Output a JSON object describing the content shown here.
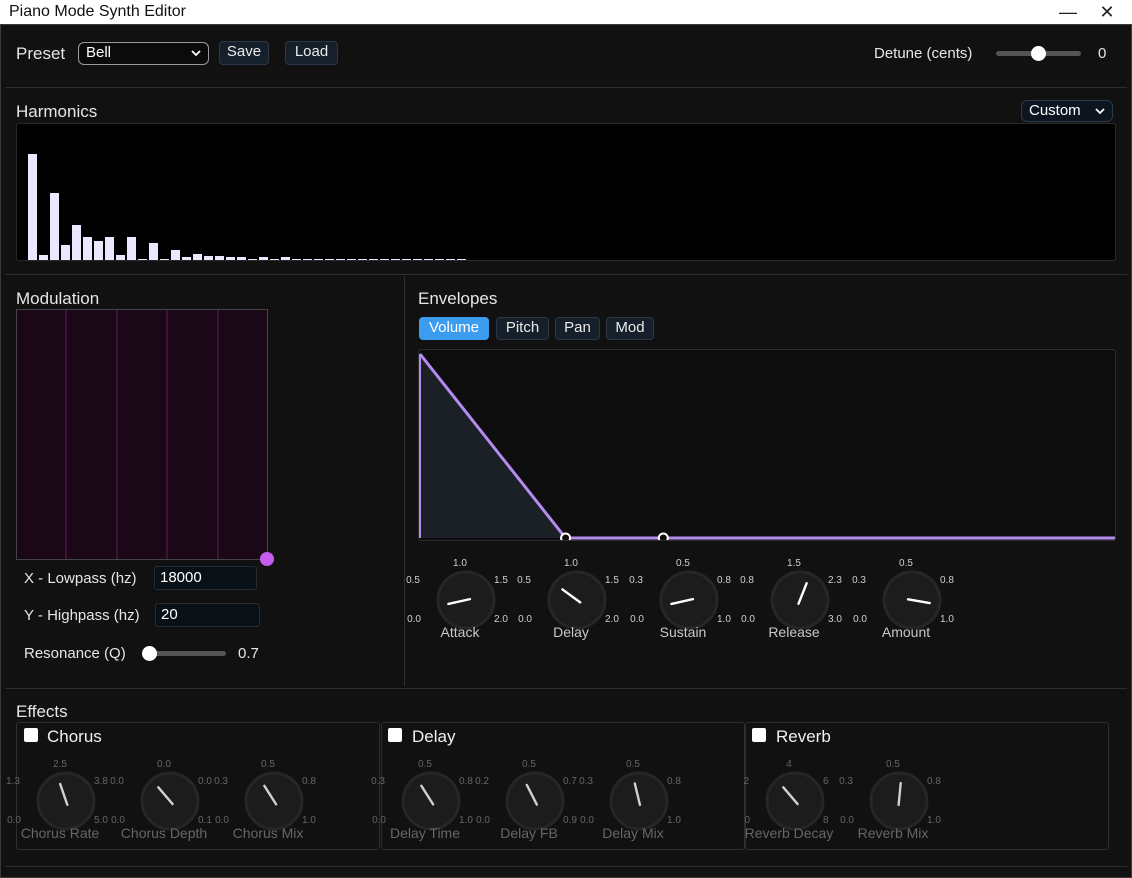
{
  "window": {
    "title": "Piano Mode Synth Editor",
    "minimize_glyph": "—",
    "close_glyph": "✕"
  },
  "preset": {
    "label": "Preset",
    "selected": "Bell",
    "save_label": "Save",
    "load_label": "Load"
  },
  "detune": {
    "label": "Detune (cents)",
    "value": "0",
    "level": 0.5
  },
  "harmonics": {
    "title": "Harmonics",
    "mode_selected": "Custom",
    "levels": [
      0.83,
      0.04,
      0.52,
      0.12,
      0.27,
      0.18,
      0.15,
      0.18,
      0.04,
      0.18,
      0.01,
      0.13,
      0.0,
      0.08,
      0.02,
      0.05,
      0.03,
      0.03,
      0.02,
      0.02,
      0.01,
      0.02,
      0.0,
      0.02,
      0.0,
      0.01,
      0.0,
      0.01,
      0.0,
      0.01,
      0.0,
      0.005,
      0.005,
      0.005,
      0.005,
      0.005,
      0.005,
      0.005,
      0.005,
      0.005
    ]
  },
  "modulation": {
    "title": "Modulation",
    "x_label": "X - Lowpass (hz)",
    "x_value": "18000",
    "y_label": "Y - Highpass (hz)",
    "y_value": "20",
    "resonance_label": "Resonance (Q)",
    "resonance_value": "0.7",
    "resonance_level": 0.0,
    "pad_x": 1.0,
    "pad_y": 0.0
  },
  "envelopes": {
    "title": "Envelopes",
    "tabs": [
      {
        "label": "Volume",
        "active": true
      },
      {
        "label": "Pitch",
        "active": false
      },
      {
        "label": "Pan",
        "active": false
      },
      {
        "label": "Mod",
        "active": false
      }
    ],
    "curve": {
      "attack_peak": 1.0,
      "decay_end": 0.21,
      "sustain": 0.0,
      "hold_end": 0.35,
      "release_end": 1.0
    },
    "knobs": [
      {
        "name": "attack",
        "label": "Attack",
        "min": "0.0",
        "max": "2.0",
        "low": "0.5",
        "mid": "1.0",
        "high": "1.5",
        "value": 0.12
      },
      {
        "name": "delay",
        "label": "Delay",
        "min": "0.0",
        "max": "2.0",
        "low": "0.5",
        "mid": "1.0",
        "high": "1.5",
        "value": 0.3
      },
      {
        "name": "sustain",
        "label": "Sustain",
        "min": "0.0",
        "max": "1.0",
        "low": "0.3",
        "mid": "0.5",
        "high": "0.8",
        "value": 0.12
      },
      {
        "name": "release",
        "label": "Release",
        "min": "0.0",
        "max": "3.0",
        "low": "0.8",
        "mid": "1.5",
        "high": "2.3",
        "value": 0.58
      },
      {
        "name": "amount",
        "label": "Amount",
        "min": "0.0",
        "max": "1.0",
        "low": "0.3",
        "mid": "0.5",
        "high": "0.8",
        "value": 0.87
      }
    ]
  },
  "effects": {
    "title": "Effects",
    "groups": [
      {
        "name": "chorus",
        "title": "Chorus",
        "enabled": false,
        "knobs": [
          {
            "name": "chorus-rate",
            "label": "Chorus Rate",
            "min": "0.0",
            "max": "5.0",
            "low": "1.3",
            "mid": "2.5",
            "high": "3.8",
            "value": 0.43
          },
          {
            "name": "chorus-depth",
            "label": "Chorus Depth",
            "min": "0.0",
            "max": "0.1",
            "low": "0.0",
            "mid": "0.0",
            "high": "0.0",
            "value": 0.35
          },
          {
            "name": "chorus-mix",
            "label": "Chorus Mix",
            "min": "0.0",
            "max": "1.0",
            "low": "0.3",
            "mid": "0.5",
            "high": "0.8",
            "value": 0.38
          }
        ]
      },
      {
        "name": "delay",
        "title": "Delay",
        "enabled": false,
        "knobs": [
          {
            "name": "delay-time",
            "label": "Delay Time",
            "min": "0.0",
            "max": "1.0",
            "low": "0.3",
            "mid": "0.5",
            "high": "0.8",
            "value": 0.38
          },
          {
            "name": "delay-fb",
            "label": "Delay FB",
            "min": "0.0",
            "max": "0.9",
            "low": "0.2",
            "mid": "0.5",
            "high": "0.7",
            "value": 0.4
          },
          {
            "name": "delay-mix",
            "label": "Delay Mix",
            "min": "0.0",
            "max": "1.0",
            "low": "0.3",
            "mid": "0.5",
            "high": "0.8",
            "value": 0.45
          }
        ]
      },
      {
        "name": "reverb",
        "title": "Reverb",
        "enabled": false,
        "knobs": [
          {
            "name": "reverb-decay",
            "label": "Reverb Decay",
            "min": "0",
            "max": "8",
            "low": "2",
            "mid": "4",
            "high": "6",
            "value": 0.35
          },
          {
            "name": "reverb-mix",
            "label": "Reverb Mix",
            "min": "0.0",
            "max": "1.0",
            "low": "0.3",
            "mid": "0.5",
            "high": "0.8",
            "value": 0.52
          }
        ]
      }
    ]
  }
}
